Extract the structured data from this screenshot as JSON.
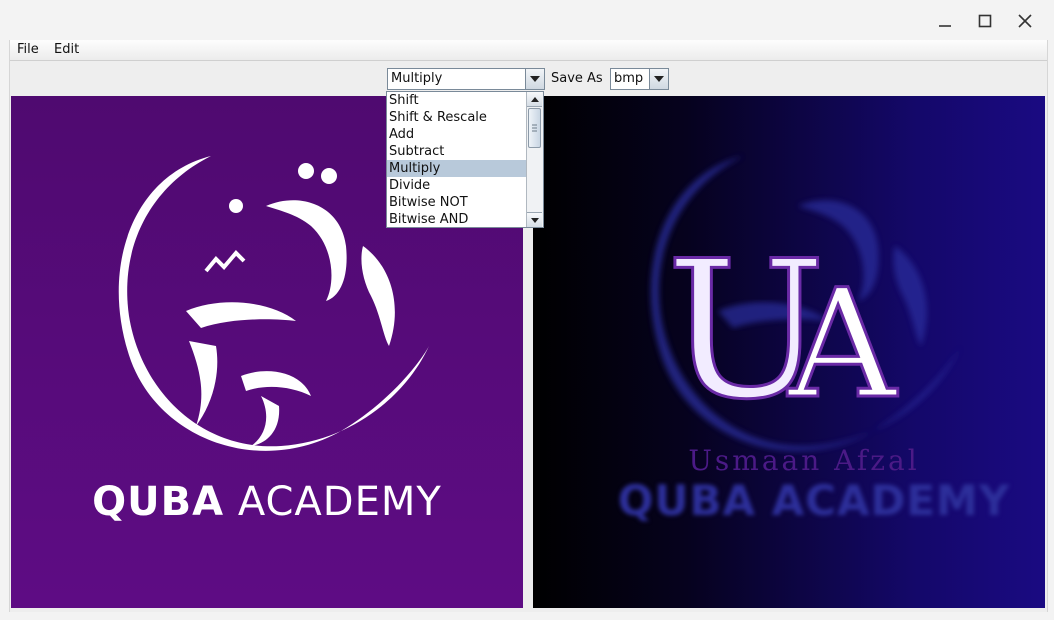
{
  "menubar": {
    "file": "File",
    "edit": "Edit"
  },
  "toolbar": {
    "operation_selected": "Multiply",
    "save_as_label": "Save As",
    "format_selected": "bmp"
  },
  "dropdown": {
    "items": [
      "Shift",
      "Shift & Rescale",
      "Add",
      "Subtract",
      "Multiply",
      "Divide",
      "Bitwise NOT",
      "Bitwise AND"
    ],
    "selected": "Multiply"
  },
  "left_image": {
    "logo_text_bold": "QUBA",
    "logo_text_light": "ACADEMY"
  },
  "right_image": {
    "monogram": "UA",
    "name_text": "Usmaan Afzal",
    "logo_text": "QUBA ACADEMY"
  },
  "colors": {
    "left_bg": "#5a0b7e",
    "right_bg_dark": "#000000",
    "right_bg_blue": "#1a0a82",
    "selection": "#b8c9da"
  },
  "icons": [
    "minimize-icon",
    "maximize-icon",
    "close-icon",
    "dropdown-arrow-icon",
    "scroll-up-icon",
    "scroll-down-icon"
  ]
}
